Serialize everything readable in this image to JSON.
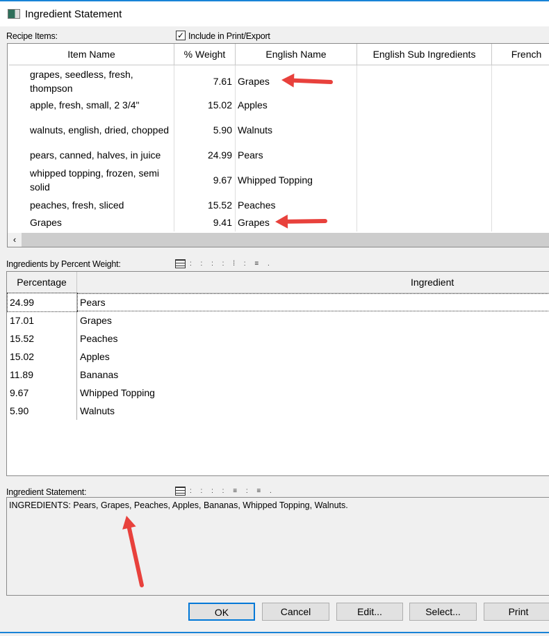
{
  "window": {
    "title": "Ingredient Statement"
  },
  "recipe": {
    "label": "Recipe Items:",
    "include_label": "Include in Print/Export",
    "include_checked": true,
    "columns": [
      "Item Name",
      "% Weight",
      "English Name",
      "English Sub Ingredients",
      "French"
    ],
    "rows": [
      {
        "item": "grapes, seedless, fresh, thompson",
        "weight": "7.61",
        "english": "Grapes"
      },
      {
        "item": "apple, fresh, small, 2 3/4\"",
        "weight": "15.02",
        "english": "Apples"
      },
      {
        "item": "walnuts, english, dried, chopped",
        "weight": "5.90",
        "english": "Walnuts"
      },
      {
        "item": "pears, canned, halves, in juice",
        "weight": "24.99",
        "english": "Pears"
      },
      {
        "item": "whipped topping, frozen, semi solid",
        "weight": "9.67",
        "english": "Whipped Topping"
      },
      {
        "item": "peaches, fresh, sliced",
        "weight": "15.52",
        "english": "Peaches"
      },
      {
        "item": "Grapes",
        "weight": "9.41",
        "english": "Grapes"
      }
    ]
  },
  "percent": {
    "label": "Ingredients by Percent Weight:",
    "columns": [
      "Percentage",
      "Ingredient"
    ],
    "rows": [
      {
        "pct": "24.99",
        "ing": "Pears"
      },
      {
        "pct": "17.01",
        "ing": "Grapes"
      },
      {
        "pct": "15.52",
        "ing": "Peaches"
      },
      {
        "pct": "15.02",
        "ing": "Apples"
      },
      {
        "pct": "11.89",
        "ing": "Bananas"
      },
      {
        "pct": "9.67",
        "ing": "Whipped Topping"
      },
      {
        "pct": "5.90",
        "ing": "Walnuts"
      }
    ]
  },
  "statement": {
    "label": "Ingredient Statement:",
    "text": "INGREDIENTS: Pears, Grapes, Peaches, Apples, Bananas, Whipped Topping, Walnuts."
  },
  "buttons": {
    "ok": "OK",
    "cancel": "Cancel",
    "edit": "Edit...",
    "select": "Select...",
    "print": "Print"
  },
  "annotation_color": "#e8413c"
}
